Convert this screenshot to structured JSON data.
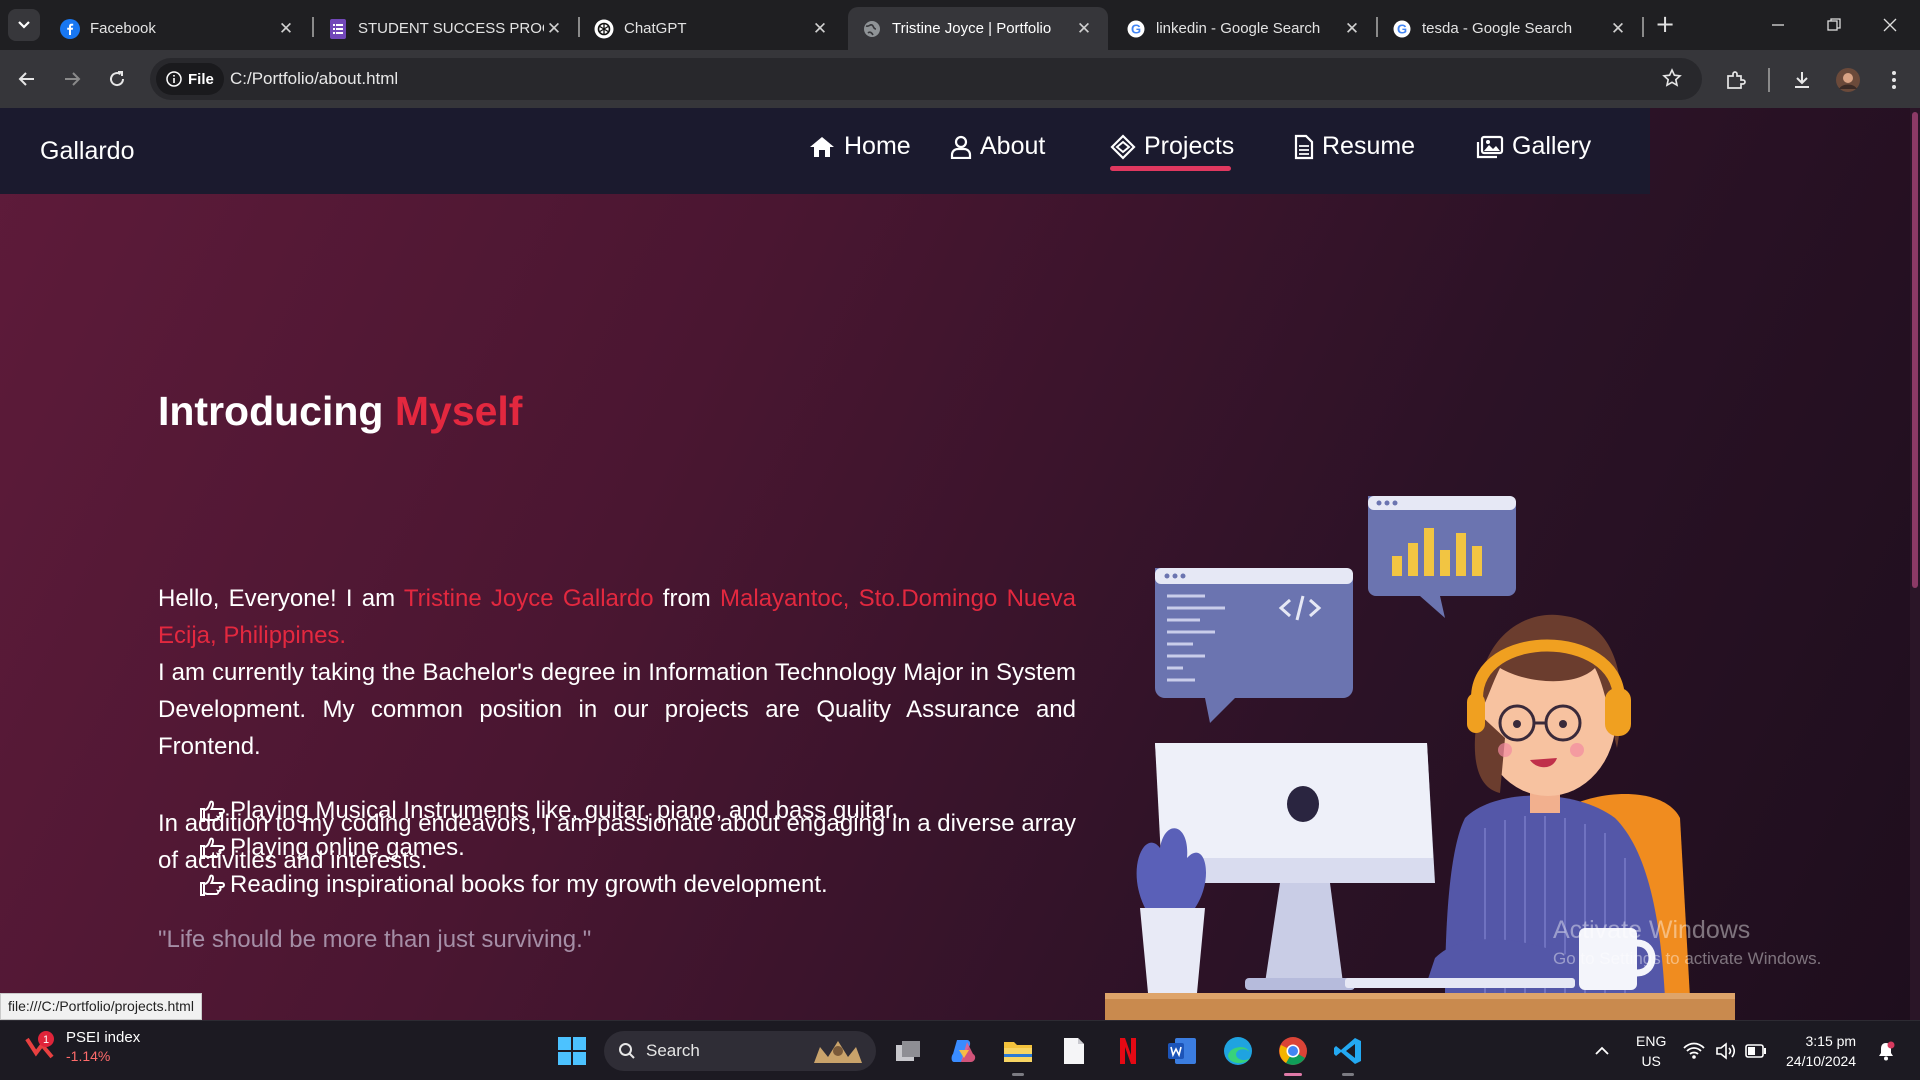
{
  "browser": {
    "tabs": [
      {
        "label": "Facebook",
        "icon": "facebook-icon"
      },
      {
        "label": "STUDENT SUCCESS PROGR",
        "icon": "forms-icon"
      },
      {
        "label": "ChatGPT",
        "icon": "chatgpt-icon"
      },
      {
        "label": "Tristine Joyce | Portfolio",
        "icon": "globe-icon",
        "active": true
      },
      {
        "label": "linkedin - Google Search",
        "icon": "google-icon"
      },
      {
        "label": "tesda - Google Search",
        "icon": "google-icon"
      }
    ],
    "close_glyph": "✕",
    "new_tab_glyph": "+",
    "file_chip": "File",
    "url": "C:/Portfolio/about.html",
    "status_url": "file:///C:/Portfolio/projects.html"
  },
  "site": {
    "brand": "Gallardo",
    "nav": [
      {
        "label": "Home",
        "icon": "home-icon"
      },
      {
        "label": "About",
        "icon": "user-icon"
      },
      {
        "label": "Projects",
        "icon": "cube-icon",
        "active": true
      },
      {
        "label": "Resume",
        "icon": "document-icon"
      },
      {
        "label": "Gallery",
        "icon": "images-icon"
      }
    ],
    "accent_color": "#e3283f"
  },
  "about": {
    "heading_part1": "Introducing ",
    "heading_part2": "Myself",
    "intro_prefix": "Hello, Everyone! I am ",
    "name": "Tristine Joyce Gallardo",
    "from_word": " from ",
    "location": "Malayantoc, Sto.Domingo Nueva Ecija, Philippines.",
    "study": "I am currently taking the Bachelor's degree in Information Technology Major in System Development. My common position in our projects are Quality Assurance and Frontend.",
    "addition": "In addition to my coding endeavors, I am passionate about engaging in a diverse array of activities and interests.",
    "interests": [
      "Playing Musical Instruments like, guitar, piano, and bass guitar.",
      "Playing online games.",
      "Reading inspirational books for my growth development."
    ],
    "quote": "\"Life should be more than just surviving.\""
  },
  "watermark": {
    "line1": "Activate Windows",
    "line2": "Go to Settings to activate Windows."
  },
  "taskbar": {
    "widget_title": "PSEI index",
    "widget_value": "-1.14%",
    "widget_badge": "1",
    "search_label": "Search",
    "lang_line1": "ENG",
    "lang_line2": "US",
    "time": "3:15 pm",
    "date": "24/10/2024"
  }
}
